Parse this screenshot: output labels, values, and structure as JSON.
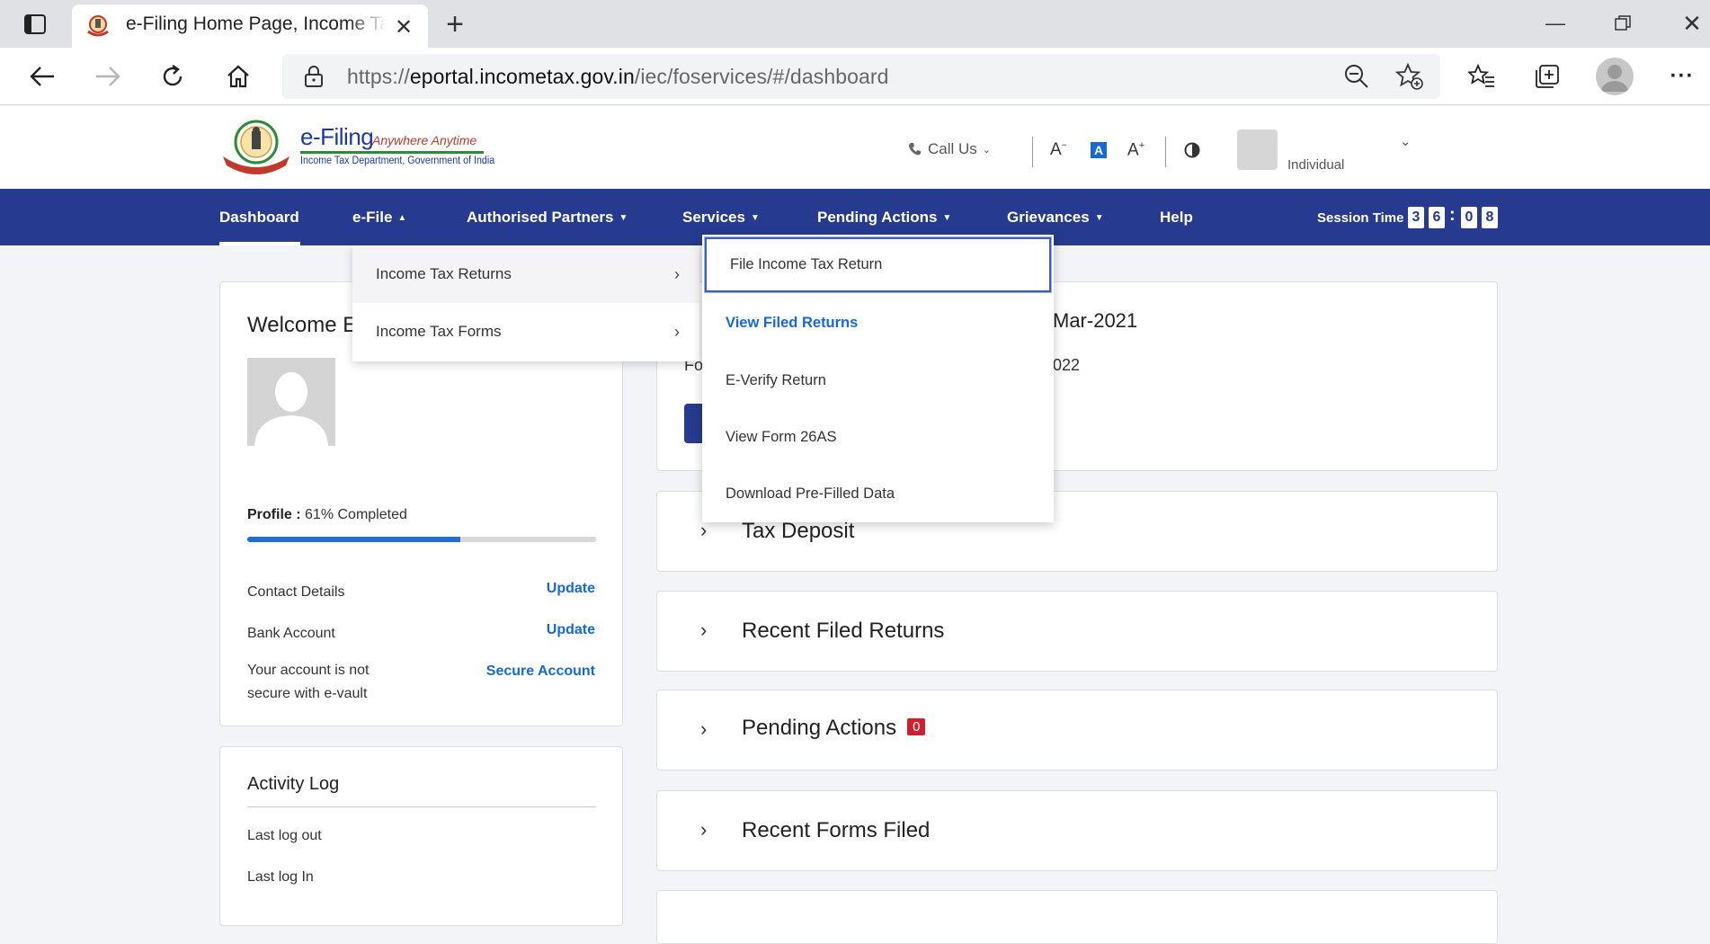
{
  "browser": {
    "tab_title": "e-Filing Home Page, Income Tax",
    "url_prefix": "https://",
    "url_domain": "eportal.incometax.gov.in",
    "url_path": "/iec/foservices/#/dashboard"
  },
  "header": {
    "logo_title": "e-Filing",
    "logo_tagline": "Anywhere Anytime",
    "logo_sub": "Income Tax Department, Government of India",
    "call_us": "Call Us",
    "font_decrease": "A",
    "font_default": "A",
    "font_increase": "A",
    "user_type": "Individual"
  },
  "nav": {
    "dashboard": "Dashboard",
    "efile": "e-File",
    "authorised_partners": "Authorised Partners",
    "services": "Services",
    "pending_actions": "Pending Actions",
    "grievances": "Grievances",
    "help": "Help",
    "session_label": "Session Time",
    "session_digits": [
      "3",
      "6",
      "0",
      "8"
    ]
  },
  "efile_menu": {
    "items": [
      "Income Tax Returns",
      "Income Tax Forms"
    ]
  },
  "itr_submenu": {
    "items": [
      "File Income Tax Return",
      "View Filed Returns",
      "E-Verify Return",
      "View Form 26AS",
      "Download Pre-Filled Data"
    ]
  },
  "profile": {
    "welcome": "Welcome E",
    "profile_label": "Profile :",
    "profile_value": "61% Completed",
    "progress": 0.61,
    "contact_label": "Contact Details",
    "contact_link": "Update",
    "bank_label": "Bank Account",
    "bank_link": "Update",
    "secure_label_1": "Your account is not",
    "secure_label_2": "secure with e-vault",
    "secure_link": "Secure Account"
  },
  "activity": {
    "title": "Activity Log",
    "last_logout": "Last log out",
    "last_login": "Last log In"
  },
  "ay_card": {
    "title_partial": "Mar-2021",
    "sub_left": "Fo",
    "sub_right": "022"
  },
  "accordions": {
    "tax_deposit": "Tax Deposit",
    "recent_returns": "Recent Filed Returns",
    "pending_actions": "Pending Actions",
    "pending_count": "0",
    "recent_forms": "Recent Forms Filed"
  },
  "colors": {
    "nav_bg": "#263b8f",
    "link": "#1769d4",
    "badge": "#d0202f"
  }
}
